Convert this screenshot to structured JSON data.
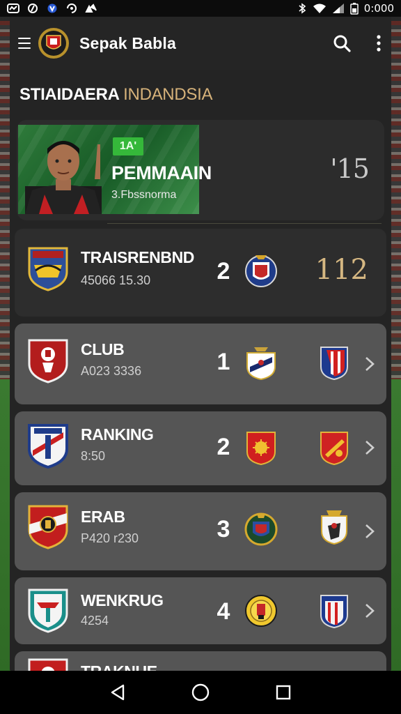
{
  "status_bar": {
    "time": "0:000",
    "left_icons": [
      "app-icon-1",
      "app-icon-2",
      "app-icon-3",
      "app-icon-4",
      "app-icon-5"
    ],
    "right_icons": [
      "bluetooth-icon",
      "wifi-icon",
      "signal-icon",
      "battery-icon"
    ]
  },
  "app_bar": {
    "title": "Sepak Babla",
    "menu_icon": "menu-icon",
    "search_icon": "search-icon",
    "more_icon": "more-vert-icon"
  },
  "section": {
    "title_part1": "STIAIDAERA",
    "title_part2": "INDANDSIA"
  },
  "featured": {
    "tag": "1A'",
    "title": "PEMMAAIN",
    "subtitle": "3.Fbssnorma",
    "value": "'15"
  },
  "rows": [
    {
      "name": "TRAISRENBND",
      "sub": "45066 15.30",
      "rank": "2",
      "value": "112",
      "style": "dark"
    },
    {
      "name": "CLUB",
      "sub": "A023 3336",
      "rank": "1"
    },
    {
      "name": "RANKING",
      "sub": "8:50",
      "rank": "2"
    },
    {
      "name": "ERAB",
      "sub": "P420 r230",
      "rank": "3"
    },
    {
      "name": "WENKRUG",
      "sub": "4254",
      "rank": "4"
    },
    {
      "name": "TRAKNUE",
      "sub": "",
      "rank": ""
    }
  ],
  "colors": {
    "accent_gold": "#d6b27a",
    "tag_green": "#35b83a",
    "row_bg": "#555555",
    "row_dark_bg": "#2d2d2d"
  },
  "navbar": {
    "back_icon": "back-triangle-icon",
    "home_icon": "home-circle-icon",
    "recents_icon": "recents-square-icon"
  }
}
